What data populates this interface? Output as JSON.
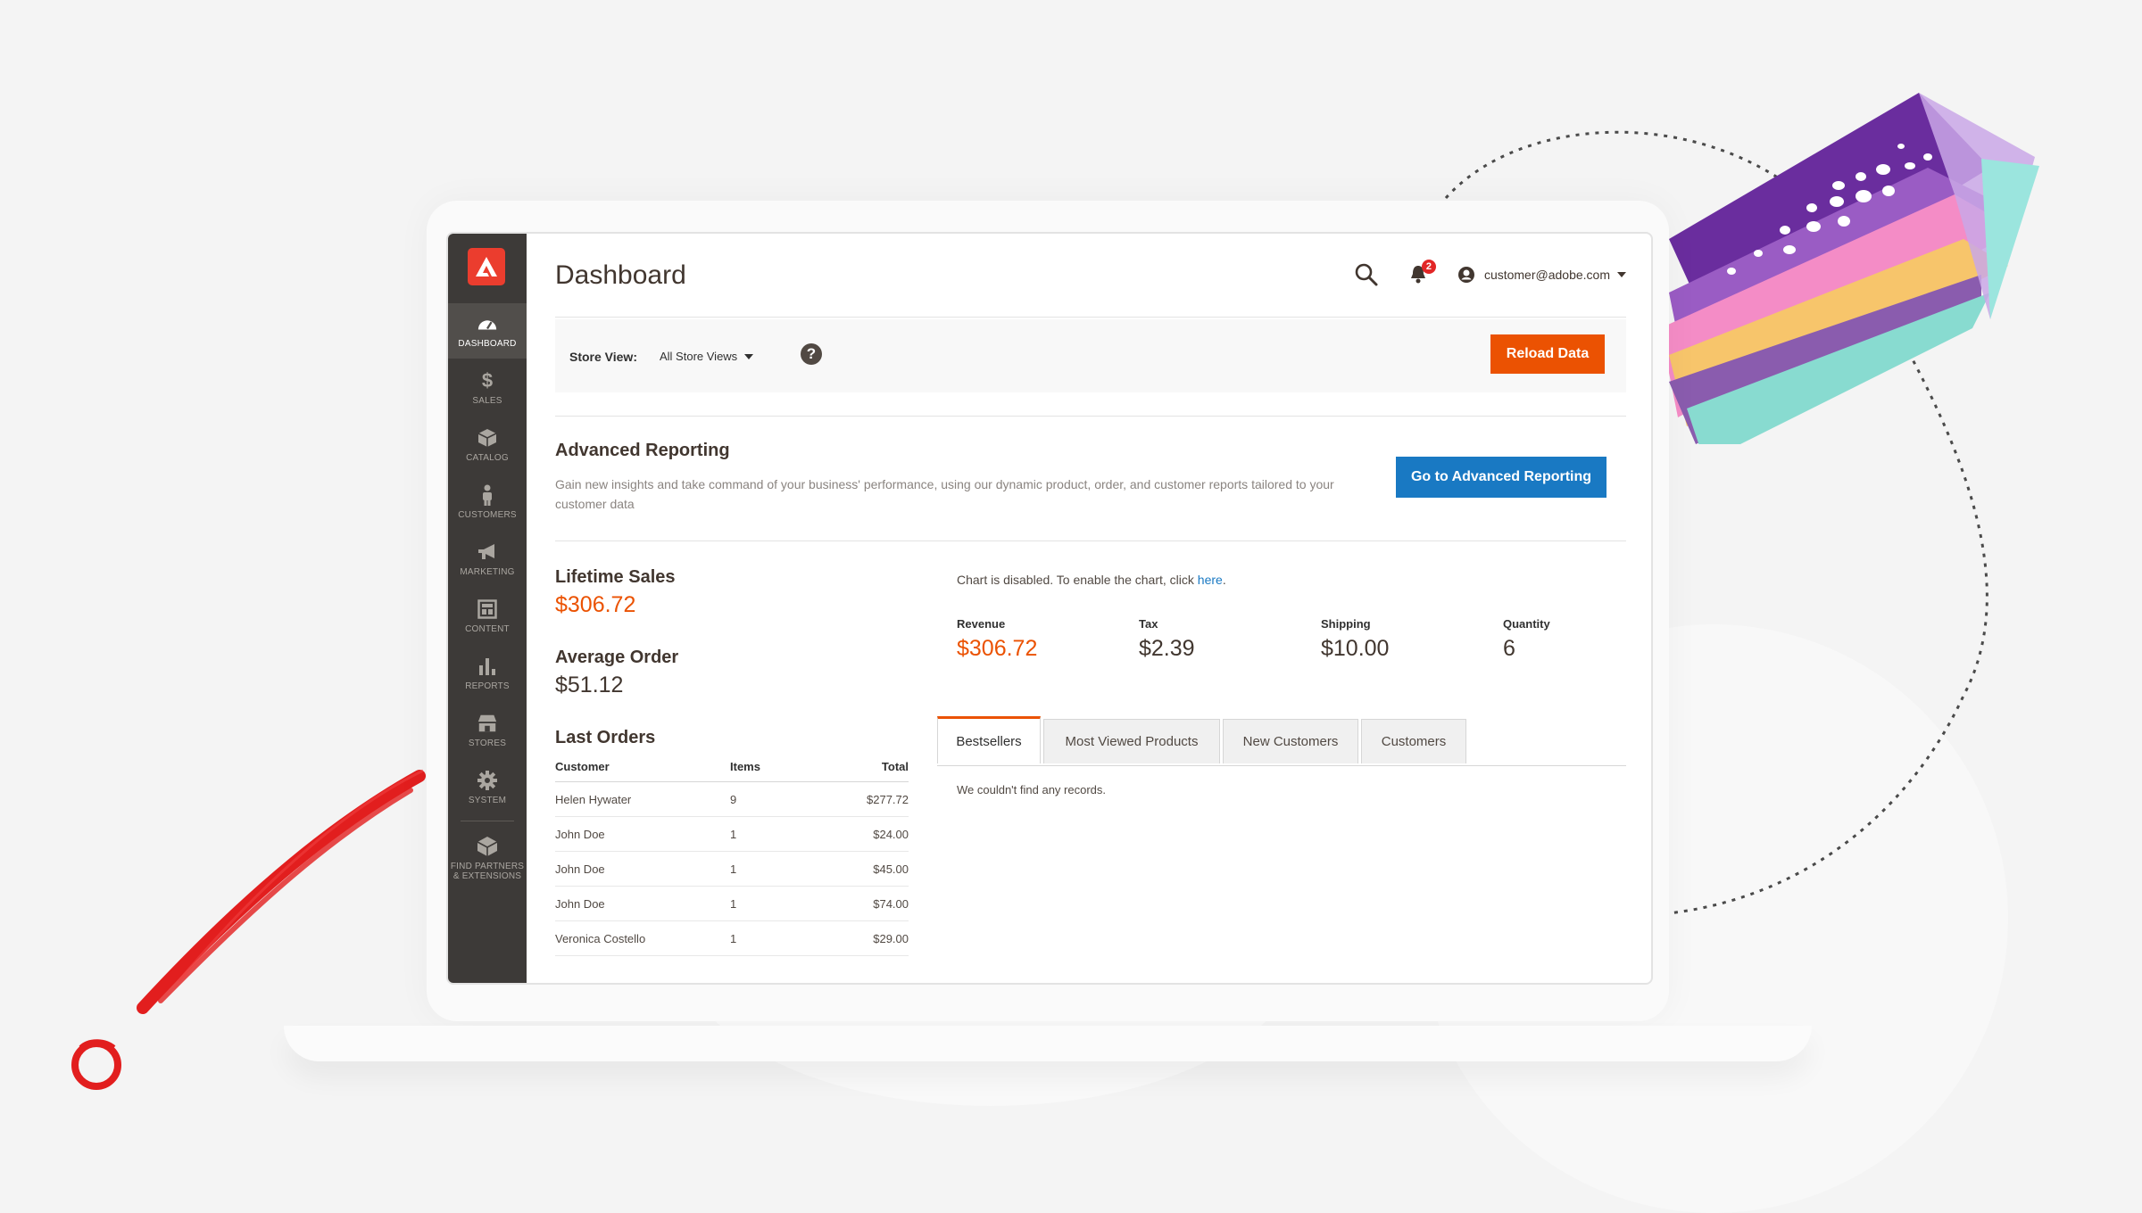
{
  "header": {
    "title": "Dashboard",
    "notification_count": "2",
    "user_email": "customer@adobe.com"
  },
  "sidebar": {
    "items": [
      {
        "label": "DASHBOARD",
        "icon": "dashboard-icon",
        "active": true
      },
      {
        "label": "SALES",
        "icon": "dollar-icon"
      },
      {
        "label": "CATALOG",
        "icon": "box-icon"
      },
      {
        "label": "CUSTOMERS",
        "icon": "person-icon"
      },
      {
        "label": "MARKETING",
        "icon": "megaphone-icon"
      },
      {
        "label": "CONTENT",
        "icon": "layout-icon"
      },
      {
        "label": "REPORTS",
        "icon": "bar-chart-icon"
      },
      {
        "label": "STORES",
        "icon": "store-icon"
      },
      {
        "label": "SYSTEM",
        "icon": "gear-icon"
      },
      {
        "label_lines": [
          "FIND PARTNERS",
          "& EXTENSIONS"
        ],
        "icon": "cube-icon"
      }
    ]
  },
  "store_bar": {
    "label": "Store View:",
    "selected": "All Store Views",
    "help": "?",
    "reload_label": "Reload Data"
  },
  "advanced_reporting": {
    "title": "Advanced Reporting",
    "description": "Gain new insights and take command of your business' performance, using our dynamic product, order, and customer reports tailored to your customer data",
    "button_label": "Go to Advanced Reporting"
  },
  "stats": {
    "lifetime_sales_label": "Lifetime Sales",
    "lifetime_sales_value": "$306.72",
    "average_order_label": "Average Order",
    "average_order_value": "$51.12"
  },
  "last_orders": {
    "title": "Last Orders",
    "columns": [
      "Customer",
      "Items",
      "Total"
    ],
    "rows": [
      {
        "customer": "Helen Hywater",
        "items": "9",
        "total": "$277.72"
      },
      {
        "customer": "John Doe",
        "items": "1",
        "total": "$24.00"
      },
      {
        "customer": "John Doe",
        "items": "1",
        "total": "$45.00"
      },
      {
        "customer": "John Doe",
        "items": "1",
        "total": "$74.00"
      },
      {
        "customer": "Veronica Costello",
        "items": "1",
        "total": "$29.00"
      }
    ]
  },
  "chart_notice": {
    "text": "Chart is disabled. To enable the chart, click ",
    "link": "here",
    "suffix": "."
  },
  "metrics": [
    {
      "label": "Revenue",
      "value": "$306.72",
      "accent": true
    },
    {
      "label": "Tax",
      "value": "$2.39"
    },
    {
      "label": "Shipping",
      "value": "$10.00"
    },
    {
      "label": "Quantity",
      "value": "6"
    }
  ],
  "tabs": [
    {
      "label": "Bestsellers",
      "active": true
    },
    {
      "label": "Most Viewed Products"
    },
    {
      "label": "New Customers"
    },
    {
      "label": "Customers"
    }
  ],
  "tab_content": {
    "empty_message": "We couldn't find any records."
  },
  "colors": {
    "accent_orange": "#eb5202",
    "primary_blue": "#1979c3",
    "sidebar_bg": "#3d3a38",
    "adobe_red": "#eb3d2e"
  }
}
